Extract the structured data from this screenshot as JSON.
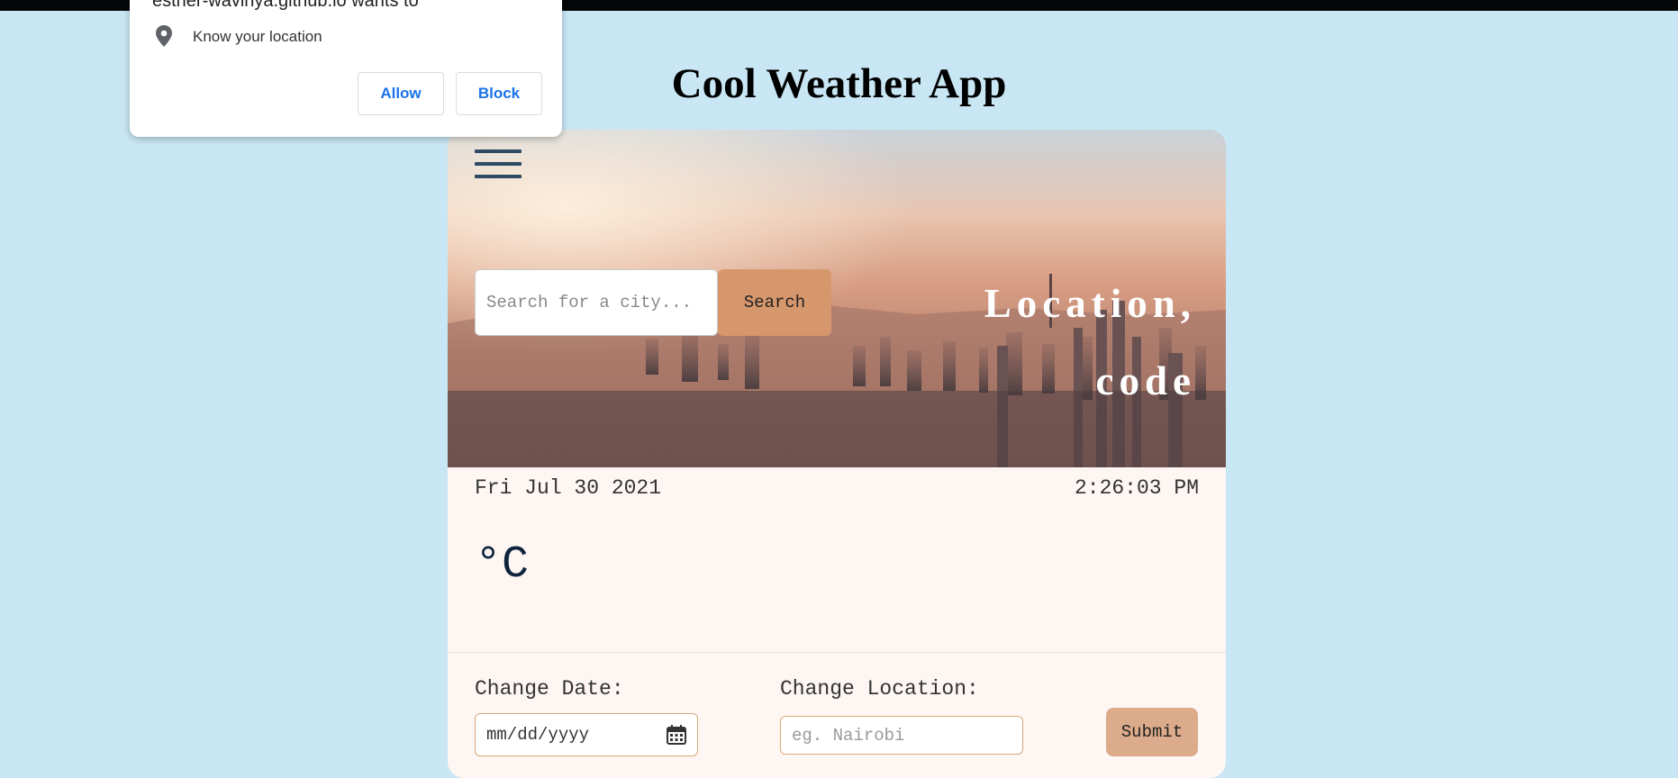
{
  "app": {
    "title": "Cool Weather App"
  },
  "permission_popup": {
    "title": "esther-wavinya.github.io wants to",
    "permission_text": "Know your location",
    "allow_label": "Allow",
    "block_label": "Block",
    "icon": "location-pin-icon"
  },
  "hero": {
    "menu_icon": "hamburger-menu-icon",
    "search_placeholder": "Search for a city...",
    "search_value": "",
    "search_button": "Search",
    "location_line1": "Location,",
    "location_line2": "code"
  },
  "info": {
    "date": "Fri Jul 30 2021",
    "time": "2:26:03 PM",
    "temperature": "°C"
  },
  "form": {
    "change_date_label": "Change Date:",
    "date_placeholder": "mm/dd/yyyy",
    "calendar_icon": "calendar-icon",
    "change_location_label": "Change Location:",
    "location_placeholder": "eg. Nairobi",
    "submit_label": "Submit"
  },
  "colors": {
    "page_background": "#c8e6f4",
    "card_background": "#fdf6f3",
    "search_button": "#d7976d",
    "submit_button": "#dcab8b",
    "accent_blue": "#1a73e8"
  }
}
